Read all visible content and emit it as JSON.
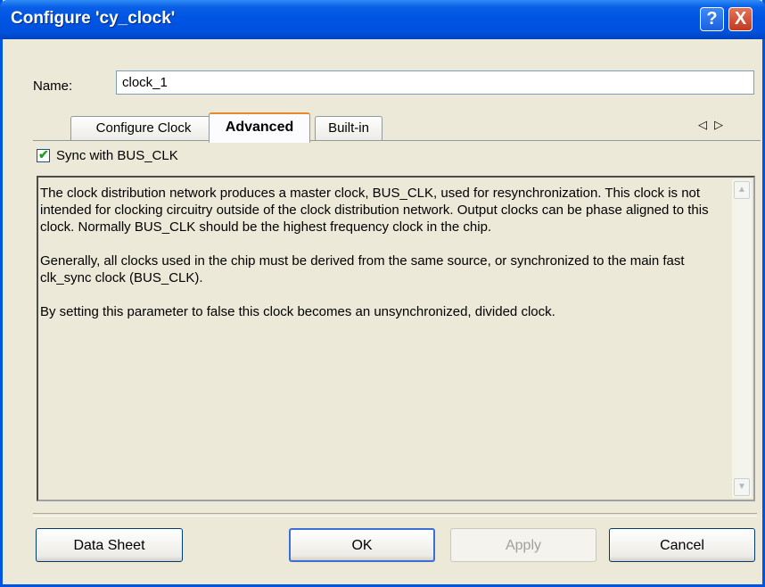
{
  "window": {
    "title": "Configure 'cy_clock'",
    "help_label": "?",
    "close_label": "X"
  },
  "name_field": {
    "label": "Name:",
    "value": "clock_1"
  },
  "tabs": [
    {
      "label": "Configure Clock"
    },
    {
      "label": "Advanced"
    },
    {
      "label": "Built-in"
    }
  ],
  "tab_scroll": {
    "left": "◁",
    "right": "▷"
  },
  "sync": {
    "label": "Sync with BUS_CLK",
    "checked": true,
    "mark": "✔"
  },
  "description": {
    "paragraphs": [
      "The clock distribution network produces a master clock, BUS_CLK, used for resynchronization. This clock is not intended for clocking circuitry outside of the clock distribution network. Output clocks can be phase aligned to this clock. Normally BUS_CLK should be the highest frequency clock in the chip.",
      "Generally, all clocks used in the chip must be derived from the same source, or synchronized to the main fast clk_sync clock (BUS_CLK).",
      "By setting this parameter to false this clock becomes an unsynchronized, divided clock."
    ],
    "scroll_up": "▲",
    "scroll_down": "▼"
  },
  "buttons": {
    "datasheet": "Data Sheet",
    "ok": "OK",
    "apply": "Apply",
    "cancel": "Cancel"
  }
}
